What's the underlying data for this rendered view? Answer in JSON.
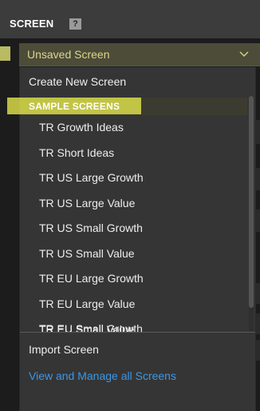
{
  "panel": {
    "title": "SCREEN",
    "help_glyph": "?"
  },
  "dropdown": {
    "selected_value": "Unsaved Screen",
    "chevron_icon": "chevron-down-icon",
    "accent_color": "#d9d68a"
  },
  "menu": {
    "create_new": "Create New Screen",
    "section_header": "SAMPLE SCREENS",
    "items": [
      "TR Growth Ideas",
      "TR Short Ideas",
      "TR US Large Growth",
      "TR US Large Value",
      "TR US Small Growth",
      "TR US Small Value",
      "TR EU Large Growth",
      "TR EU Large Value",
      "TR EU Small Growth",
      "TR EU Small Value"
    ],
    "import": "Import Screen",
    "manage": "View and Manage all Screens",
    "link_color": "#3c97e6",
    "highlight_color": "#e7eb4b"
  }
}
